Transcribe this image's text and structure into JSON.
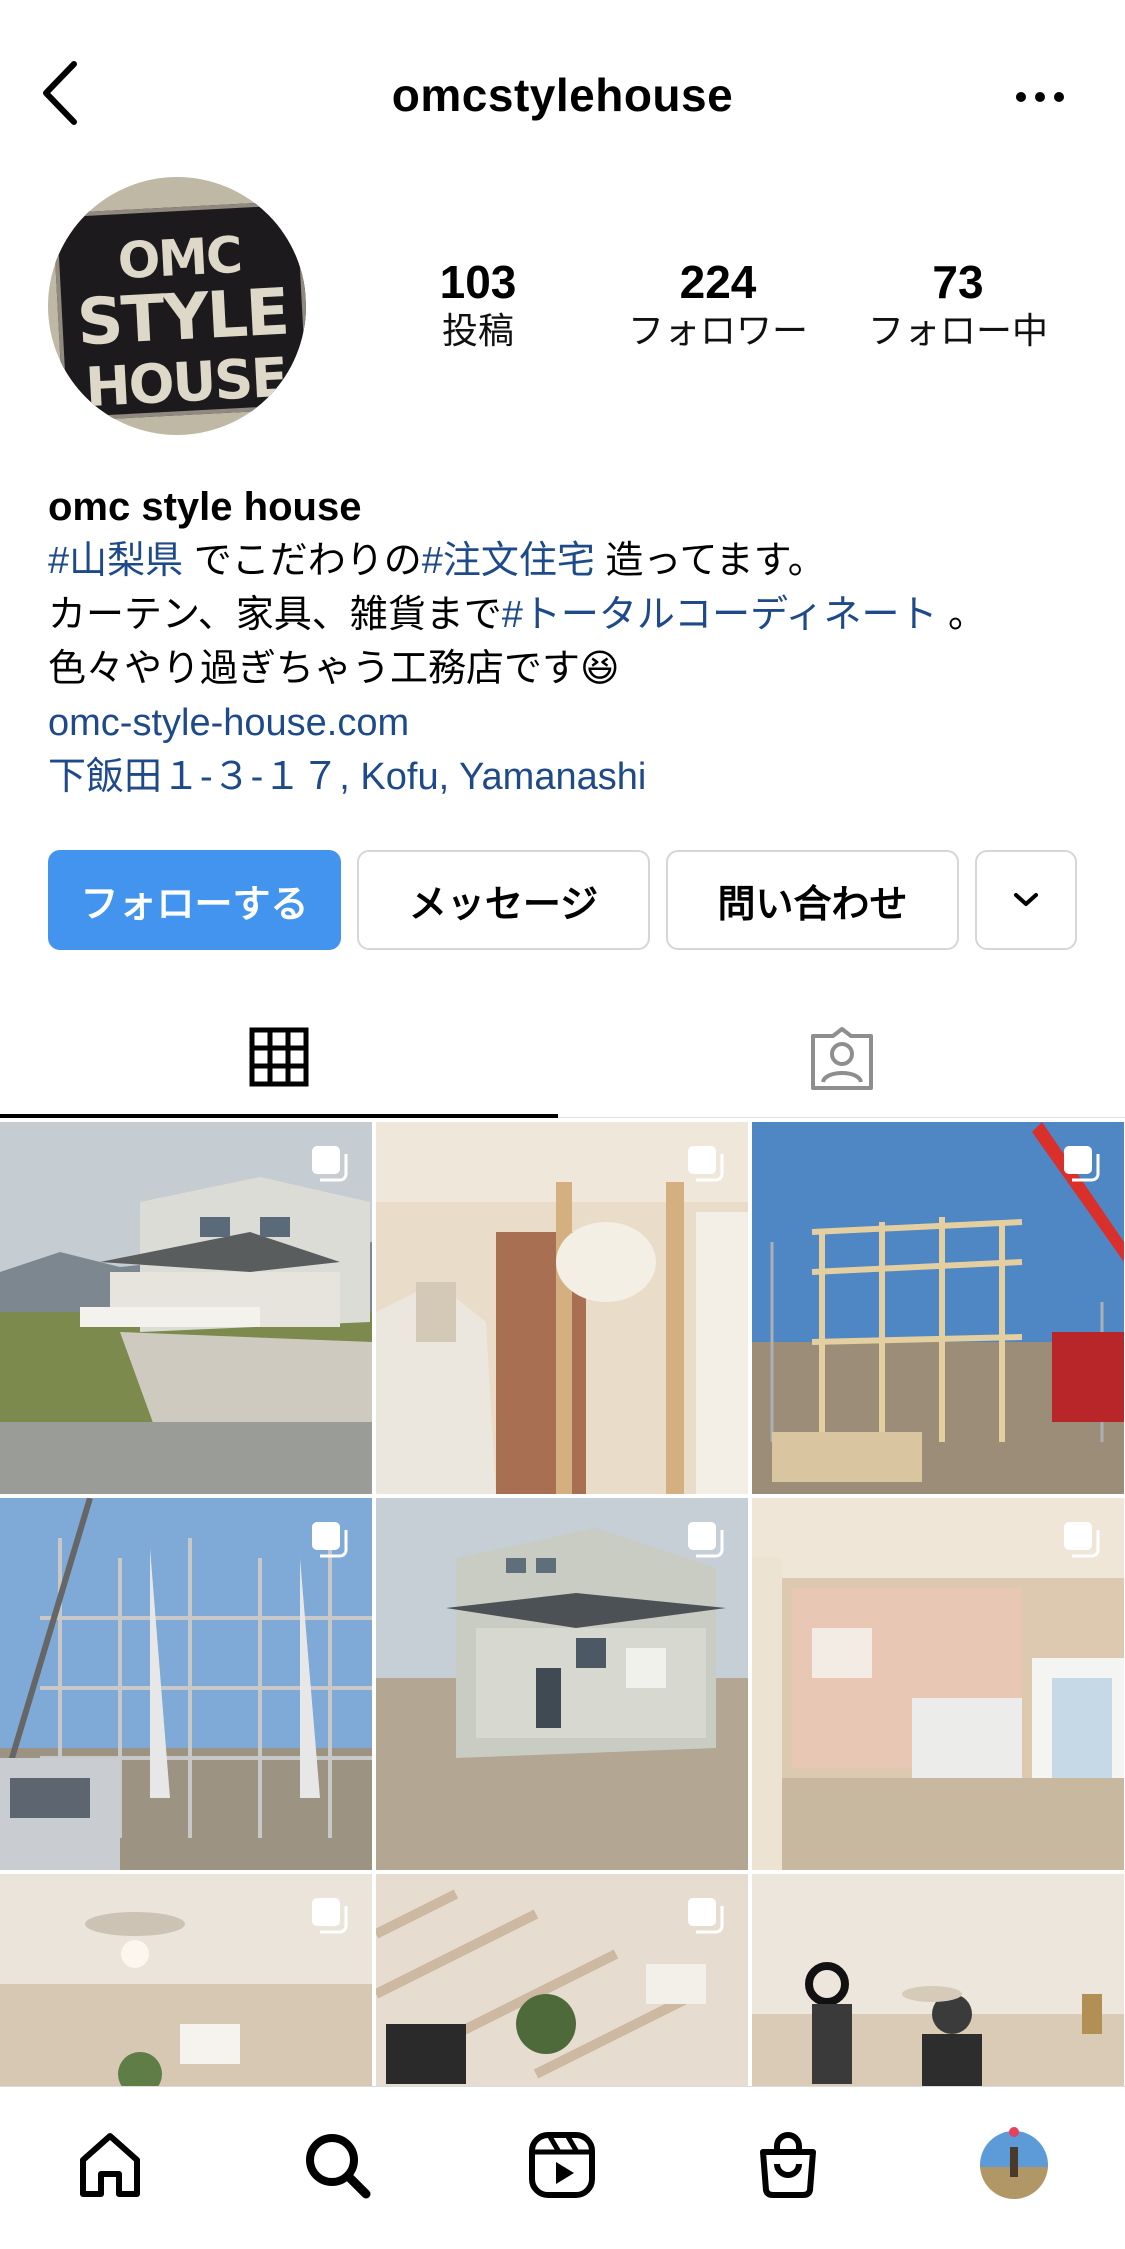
{
  "header": {
    "username": "omcstylehouse"
  },
  "avatar": {
    "line1": "OMC",
    "line2": "STYLE",
    "line3": "HOUSE"
  },
  "stats": [
    {
      "value": "103",
      "label": "投稿"
    },
    {
      "value": "224",
      "label": "フォロワー"
    },
    {
      "value": "73",
      "label": "フォロー中"
    }
  ],
  "bio": {
    "name": "omc style house",
    "line1_tag1": "#山梨県",
    "line1_text1": " でこだわりの",
    "line1_tag2": "#注文住宅",
    "line1_text2": " 造ってます。",
    "line2_text1": "カーテン、家具、雑貨まで",
    "line2_tag": "#トータルコーディネート",
    "line2_text2": " 。",
    "line3_text": "色々やり過ぎちゃう工務店です",
    "line3_emoji": "😆",
    "link": "omc-style-house.com",
    "address": "下飯田１-３-１７, Kofu, Yamanashi"
  },
  "buttons": {
    "follow": "フォローする",
    "message": "メッセージ",
    "contact": "問い合わせ"
  },
  "colors": {
    "accent": "#4294ee",
    "link": "#1f4a8a",
    "notification": "#e8405a"
  },
  "icons": [
    "back-arrow-icon",
    "more-dots-icon",
    "grid-icon",
    "tagged-icon",
    "chevron-down-icon",
    "home-icon",
    "search-icon",
    "reels-icon",
    "shop-icon",
    "profile-avatar-icon",
    "multiple-posts-icon"
  ]
}
